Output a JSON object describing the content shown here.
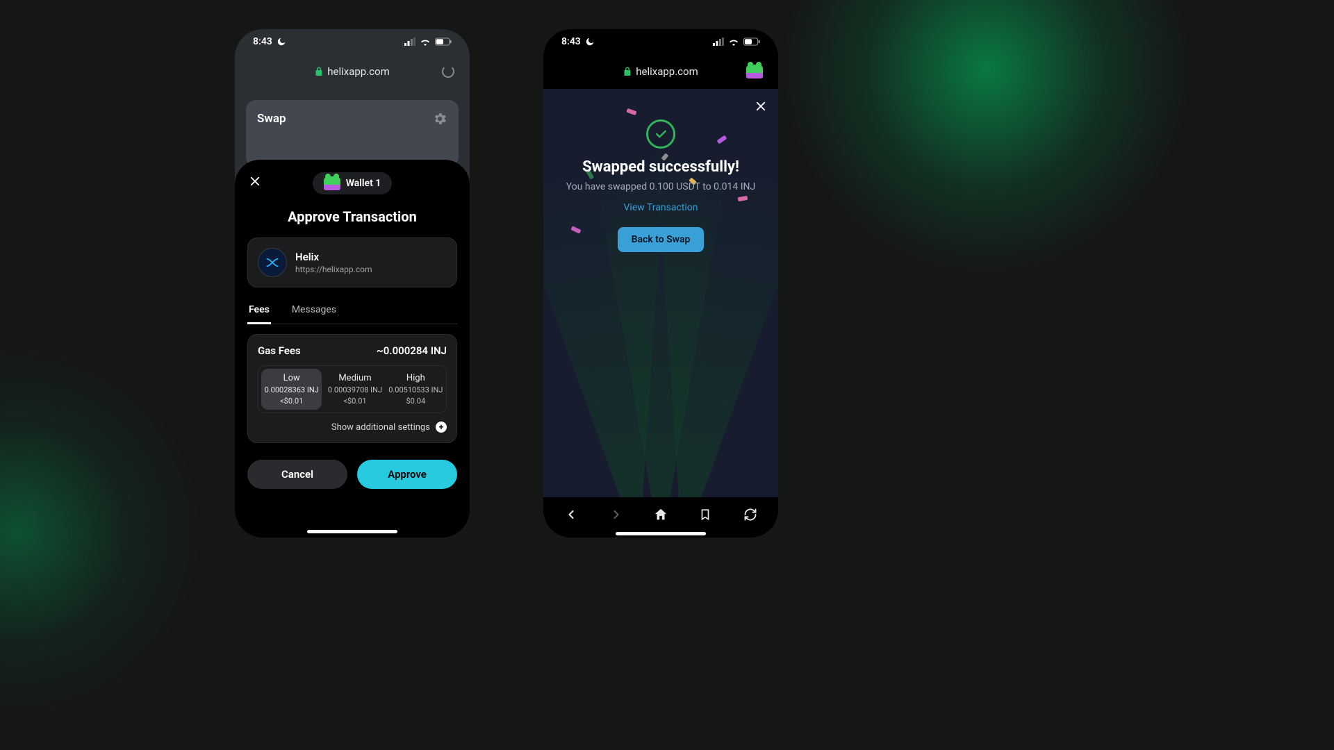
{
  "status": {
    "time": "8:43"
  },
  "url_text": "helixapp.com",
  "left": {
    "swap_title": "Swap",
    "sheet": {
      "wallet_pill": "Wallet 1",
      "title": "Approve Transaction",
      "app": {
        "name": "Helix",
        "url": "https://helixapp.com"
      },
      "tabs": {
        "fees": "Fees",
        "messages": "Messages"
      },
      "gas": {
        "heading": "Gas Fees",
        "estimate": "~0.000284 INJ",
        "options": [
          {
            "label": "Low",
            "amount": "0.00028363 INJ",
            "usd": "<$0.01"
          },
          {
            "label": "Medium",
            "amount": "0.00039708 INJ",
            "usd": "<$0.01"
          },
          {
            "label": "High",
            "amount": "0.00510533 INJ",
            "usd": "$0.04"
          }
        ],
        "settings_label": "Show additional settings"
      },
      "actions": {
        "cancel": "Cancel",
        "approve": "Approve"
      }
    }
  },
  "right": {
    "success_title": "Swapped successfully!",
    "success_sub": "You have swapped 0.100 USDT to 0.014 INJ",
    "view_link": "View Transaction",
    "back_button": "Back to Swap"
  },
  "colors": {
    "accent_cyan": "#28cae0",
    "accent_blue": "#3aa0d8",
    "success_green": "#30b558"
  }
}
